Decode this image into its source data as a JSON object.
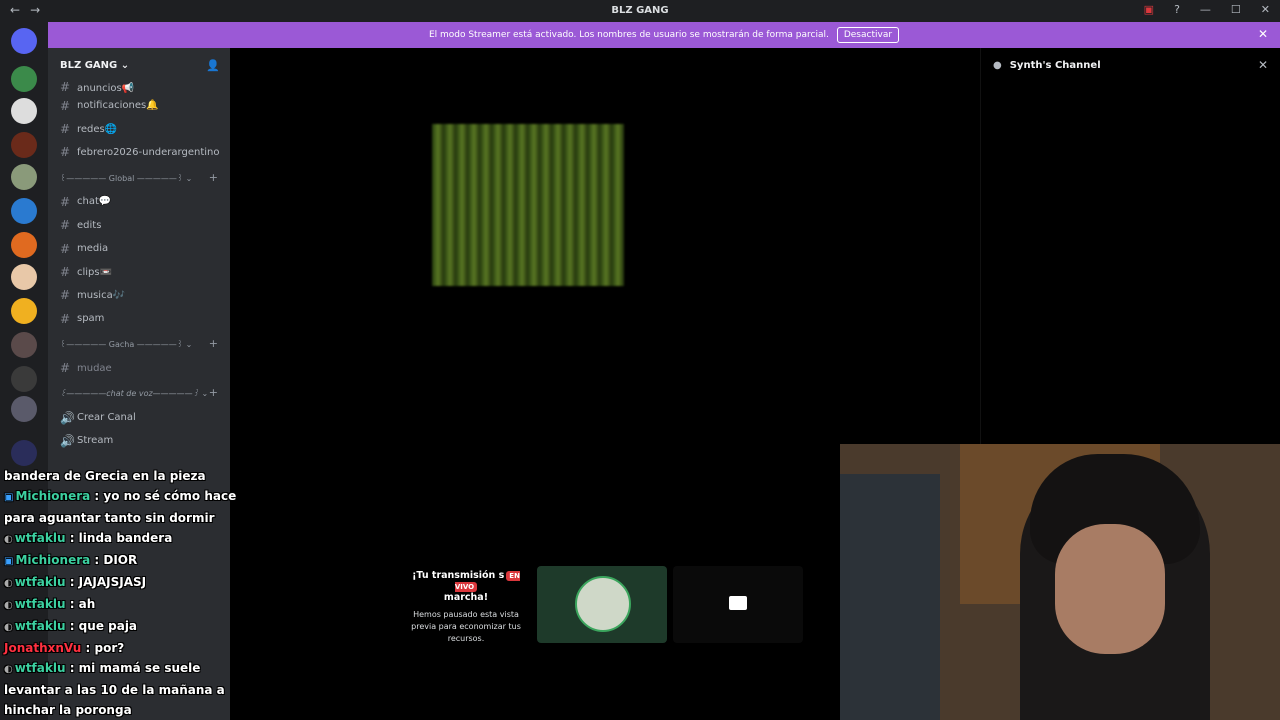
{
  "window": {
    "title": "BLZ GANG"
  },
  "banner": {
    "text": "El modo Streamer está activado. Los nombres de usuario se mostrarán de forma parcial.",
    "button": "Desactivar"
  },
  "guild": {
    "name": "BLZ GANG ⌄"
  },
  "channels_top": [
    {
      "name": "anuncios📢"
    },
    {
      "name": "notificaciones🔔"
    },
    {
      "name": "redes🌐"
    },
    {
      "name": "febrero2026-underargentino"
    }
  ],
  "categories": [
    {
      "label": "꒰————— Global —————꒱  ⌄"
    },
    {
      "label": "꒰————— Gacha —————꒱  ⌄"
    },
    {
      "label": "꒰—————chat de voz—————꒱  ⌄"
    }
  ],
  "channels_global": [
    {
      "name": "chat💬"
    },
    {
      "name": "edits"
    },
    {
      "name": "media"
    },
    {
      "name": "clips📼"
    },
    {
      "name": "musica🎶"
    },
    {
      "name": "spam"
    }
  ],
  "channels_gacha": [
    {
      "name": "mudae"
    }
  ],
  "voice_channels": [
    {
      "name": "Crear Canal"
    },
    {
      "name": "Stream"
    }
  ],
  "right_panel": {
    "title": "Synth's Channel"
  },
  "stream_notice": {
    "title_a": "¡Tu transmisión s",
    "live_badge": "EN VIVO",
    "title_b": "marcha!",
    "desc": "Hemos pausado esta vista previa para economizar tus recursos."
  },
  "chat": [
    {
      "user": "",
      "text": "bandera de Grecia en la pieza"
    },
    {
      "user": "Michionera",
      "text": ": yo no sé cómo hace para aguantar tanto sin dormir"
    },
    {
      "user": "wtfaklu",
      "text": ": linda bandera"
    },
    {
      "user": "Michionera",
      "text": ": DIOR"
    },
    {
      "user": "wtfaklu",
      "text": ": JAJAJSJASJ"
    },
    {
      "user": "wtfaklu",
      "text": ": ah"
    },
    {
      "user": "wtfaklu",
      "text": ": que paja"
    },
    {
      "user": "JonathxnVu",
      "text": ": por?"
    },
    {
      "user": "wtfaklu",
      "text": ": mi mamá se suele levantar a las 10 de la mañana a hinchar la poronga"
    }
  ],
  "colors": {
    "banner": "#9b59d6",
    "sidebar": "#2b2d31",
    "live": "#da373c"
  }
}
